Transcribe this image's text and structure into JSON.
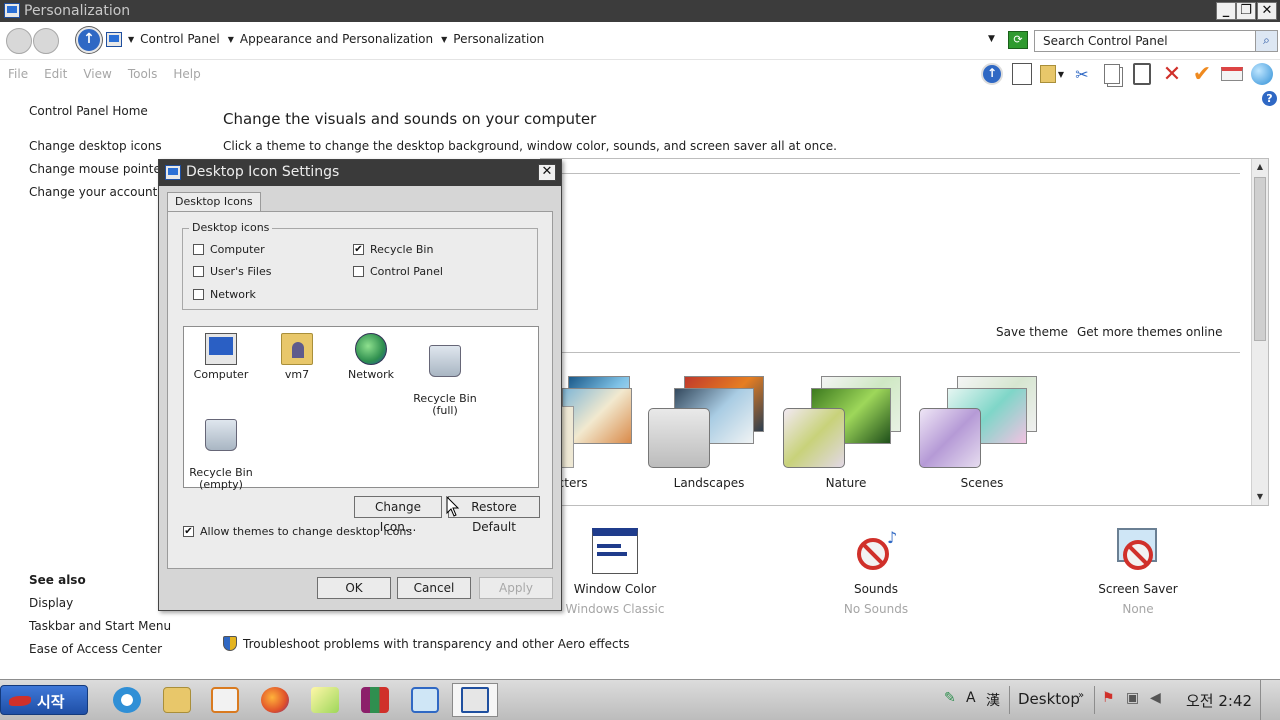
{
  "window": {
    "title": "Personalization",
    "minimize": "_",
    "maximize": "❐",
    "close": "✕"
  },
  "address": {
    "crumbs": [
      "Control Panel",
      "Appearance and Personalization",
      "Personalization"
    ],
    "search_placeholder": "Search Control Panel"
  },
  "menu": [
    "File",
    "Edit",
    "View",
    "Tools",
    "Help"
  ],
  "toolbar_icons": [
    "up-arrow-icon",
    "blank-page-icon",
    "folder-options-icon",
    "cut-icon",
    "copy-icon",
    "paste-icon",
    "delete-icon",
    "check-icon",
    "rename-icon",
    "globe-icon"
  ],
  "leftnav": {
    "home": "Control Panel Home",
    "links": [
      "Change desktop icons",
      "Change mouse pointers",
      "Change your account pi"
    ],
    "see_also_title": "See also",
    "see_also": [
      "Display",
      "Taskbar and Start Menu",
      "Ease of Access Center"
    ]
  },
  "main": {
    "heading": "Change the visuals and sounds on your computer",
    "subheading": "Click a theme to change the desktop background, window color, sounds, and screen saver all at once.",
    "save_theme": "Save theme",
    "get_more": "Get more themes online",
    "themes": [
      "aracters",
      "Landscapes",
      "Nature",
      "Scenes"
    ],
    "tiles": [
      {
        "label": "Window Color",
        "sub": "Windows Classic"
      },
      {
        "label": "Sounds",
        "sub": "No Sounds"
      },
      {
        "label": "Screen Saver",
        "sub": "None"
      }
    ],
    "troubleshoot": "Troubleshoot problems with transparency and other Aero effects"
  },
  "dialog": {
    "title": "Desktop Icon Settings",
    "close": "✕",
    "tab": "Desktop Icons",
    "group_title": "Desktop icons",
    "checkboxes": {
      "computer": {
        "label": "Computer",
        "checked": false
      },
      "recycle_bin": {
        "label": "Recycle Bin",
        "checked": true
      },
      "users_files": {
        "label": "User's Files",
        "checked": false
      },
      "control_panel": {
        "label": "Control Panel",
        "checked": false
      },
      "network": {
        "label": "Network",
        "checked": false
      }
    },
    "icons": [
      {
        "label": "Computer"
      },
      {
        "label": "vm7"
      },
      {
        "label": "Network"
      },
      {
        "label": "Recycle Bin\n(full)"
      },
      {
        "label": "Recycle Bin\n(empty)"
      }
    ],
    "change_icon": "Change Icon...",
    "restore_default": "Restore Default",
    "allow_themes": {
      "label": "Allow themes to change desktop icons",
      "checked": true
    },
    "ok": "OK",
    "cancel": "Cancel",
    "apply": "Apply"
  },
  "taskbar": {
    "start": "시작",
    "desktop": "Desktop",
    "clock": "오전 2:42",
    "ime": [
      "A",
      "漢"
    ]
  },
  "check_mark": "✔"
}
